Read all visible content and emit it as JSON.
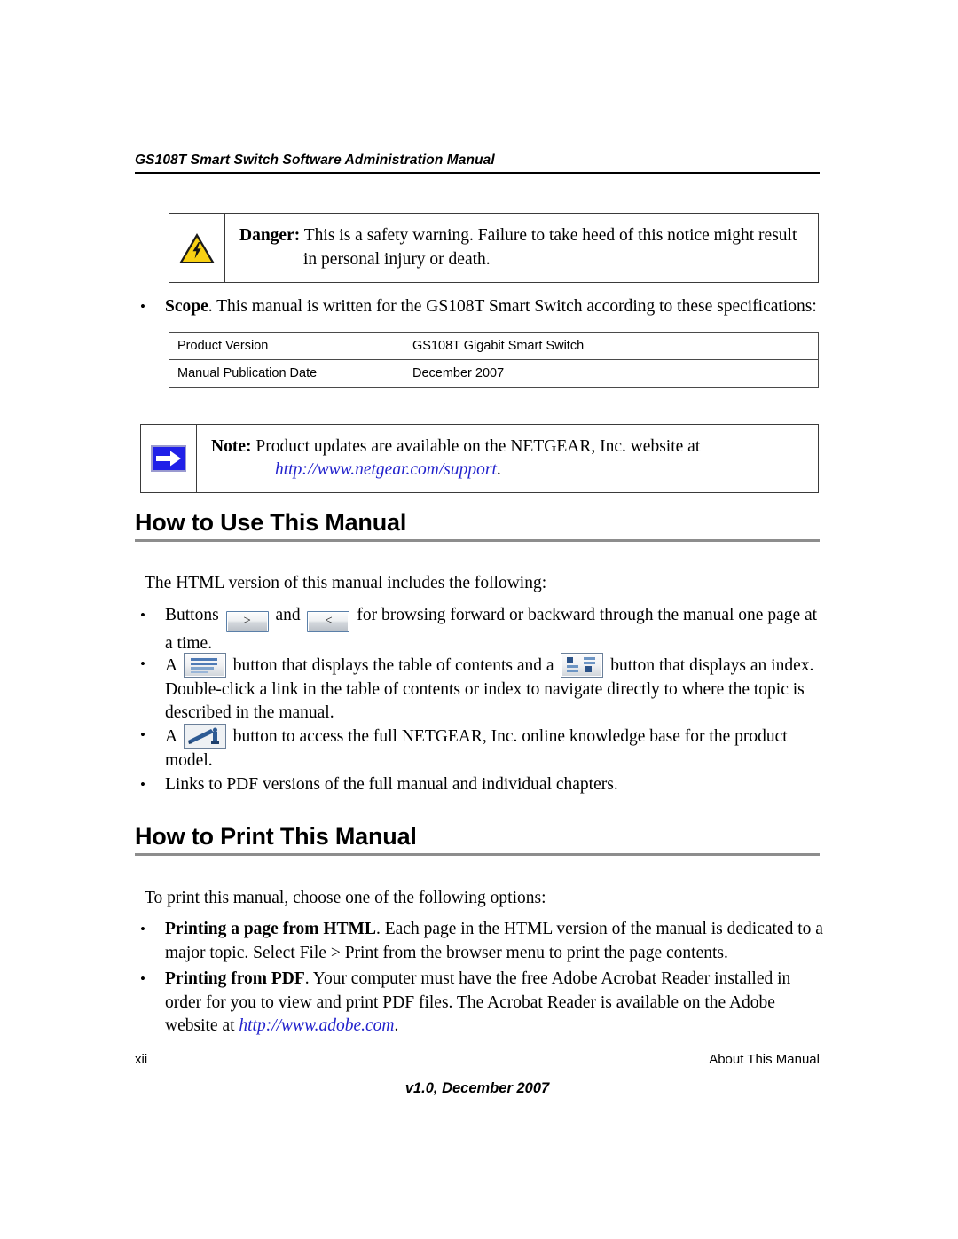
{
  "header": {
    "title": "GS108T Smart Switch Software Administration Manual"
  },
  "danger_box": {
    "icon": "warning-triangle-icon",
    "lead": "Danger:",
    "text": " This is a safety warning. Failure to take heed of this notice might result in personal injury or death."
  },
  "scope_bullet": {
    "dot": "•",
    "lead": "Scope",
    "text": ". This manual is written for the GS108T Smart Switch according to these specifications:"
  },
  "spec_table": {
    "rows": [
      {
        "label": "Product Version",
        "value": "GS108T Gigabit Smart Switch"
      },
      {
        "label": "Manual Publication Date",
        "value": "December 2007"
      }
    ]
  },
  "note_box": {
    "icon": "blue-arrow-note-icon",
    "lead": "Note:",
    "text": " Product updates are available on the NETGEAR, Inc. website at ",
    "link": "http://www.netgear.com/support",
    "trailing": "."
  },
  "section_use": {
    "title": "How to Use This Manual",
    "intro": "The HTML version of this manual includes the following:",
    "bullets": [
      {
        "dot": "•",
        "pre": "Buttons ",
        "btn1": ">",
        "mid": " and ",
        "btn2": "<",
        "post": " for browsing forward or backward through the manual one page at a time."
      },
      {
        "dot": "•",
        "pre": "A ",
        "icon1": "toc-icon",
        "mid": " button that displays the table of contents and a ",
        "icon2": "index-icon",
        "post": " button that displays an index. Double-click a link in the table of contents or index to navigate directly to where the topic is described in the manual."
      },
      {
        "dot": "•",
        "pre": "A ",
        "icon1": "knowledge-base-icon",
        "post": " button to access the full NETGEAR, Inc. online knowledge base for the product model."
      },
      {
        "dot": "•",
        "text": "Links to PDF versions of the full manual and individual chapters."
      }
    ]
  },
  "section_print": {
    "title": "How to Print This Manual",
    "intro": "To print this manual, choose one of the following options:",
    "bullets": [
      {
        "dot": "•",
        "lead": "Printing a page from HTML",
        "text": ". Each page in the HTML version of the manual is dedicated to a major topic. Select File > Print from the browser menu to print the page contents."
      },
      {
        "dot": "•",
        "lead": "Printing from PDF",
        "text": ". Your computer must have the free Adobe Acrobat Reader installed in order for you to view and print PDF files. The Acrobat Reader is available on the Adobe website at ",
        "link": "http://www.adobe.com",
        "trailing": "."
      }
    ]
  },
  "footer": {
    "page_number": "xii",
    "chapter": "About This Manual",
    "version": "v1.0, December 2007"
  },
  "colors": {
    "link": "#2222cc",
    "warning_yellow": "#f5d017",
    "note_blue": "#2020e8",
    "rule_gray": "#8d8d8d"
  }
}
